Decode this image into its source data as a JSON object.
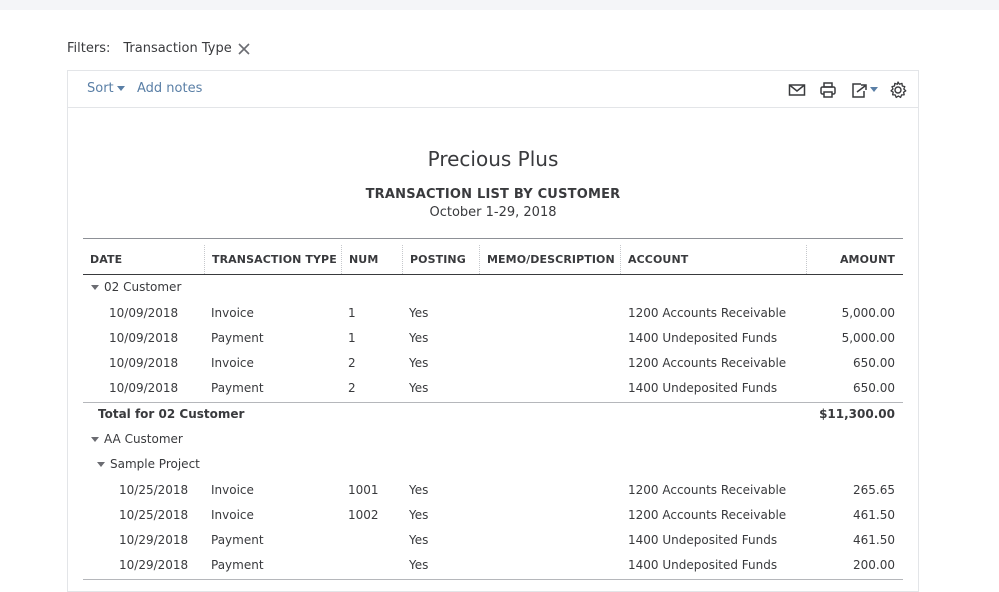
{
  "filters": {
    "label": "Filters:",
    "chip": "Transaction Type"
  },
  "toolbar": {
    "sort_label": "Sort",
    "notes_label": "Add notes",
    "icons": [
      "email-icon",
      "print-icon",
      "export-icon",
      "gear-icon"
    ]
  },
  "report": {
    "company": "Precious Plus",
    "title": "TRANSACTION LIST BY CUSTOMER",
    "date_range": "October 1-29, 2018",
    "columns": [
      "DATE",
      "TRANSACTION TYPE",
      "NUM",
      "POSTING",
      "MEMO/DESCRIPTION",
      "ACCOUNT",
      "AMOUNT"
    ],
    "groups": [
      {
        "name": "02 Customer",
        "rows": [
          [
            "10/09/2018",
            "Invoice",
            "1",
            "Yes",
            "",
            "1200 Accounts Receivable",
            "5,000.00"
          ],
          [
            "10/09/2018",
            "Payment",
            "1",
            "Yes",
            "",
            "1400 Undeposited Funds",
            "5,000.00"
          ],
          [
            "10/09/2018",
            "Invoice",
            "2",
            "Yes",
            "",
            "1200 Accounts Receivable",
            "650.00"
          ],
          [
            "10/09/2018",
            "Payment",
            "2",
            "Yes",
            "",
            "1400 Undeposited Funds",
            "650.00"
          ]
        ],
        "total_label": "Total for 02 Customer",
        "total_value": "$11,300.00"
      },
      {
        "name": "AA Customer",
        "subgroup": "Sample Project",
        "rows": [
          [
            "10/25/2018",
            "Invoice",
            "1001",
            "Yes",
            "",
            "1200 Accounts Receivable",
            "265.65"
          ],
          [
            "10/25/2018",
            "Invoice",
            "1002",
            "Yes",
            "",
            "1200 Accounts Receivable",
            "461.50"
          ],
          [
            "10/29/2018",
            "Payment",
            "",
            "Yes",
            "",
            "1400 Undeposited Funds",
            "461.50"
          ],
          [
            "10/29/2018",
            "Payment",
            "",
            "Yes",
            "",
            "1400 Undeposited Funds",
            "200.00"
          ]
        ]
      }
    ]
  }
}
